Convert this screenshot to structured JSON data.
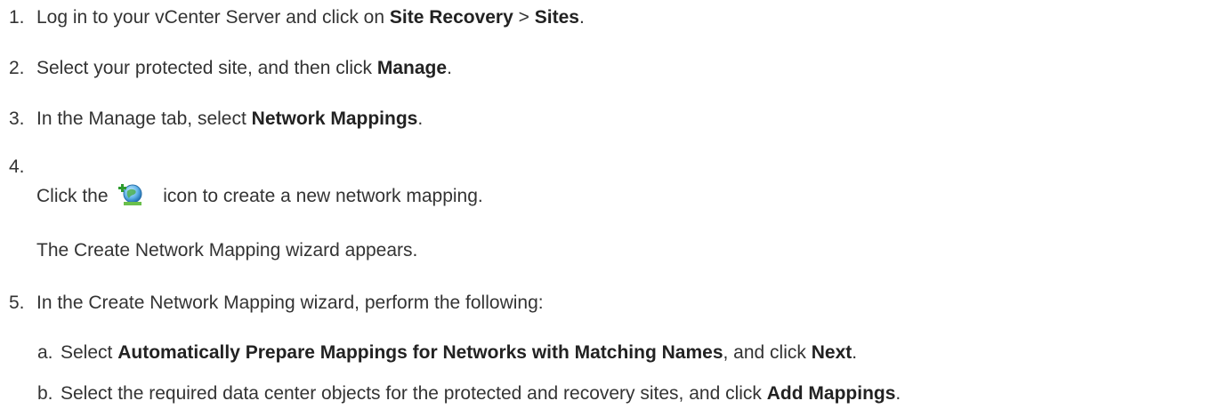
{
  "steps": [
    {
      "num": "1.",
      "t1": "Log in to your vCenter Server and click on ",
      "b1": "Site Recovery",
      "t2": " > ",
      "b2": "Sites",
      "t3": "."
    },
    {
      "num": "2.",
      "t1": "Select your protected site, and then click ",
      "b1": "Manage",
      "t2": "."
    },
    {
      "num": "3.",
      "t1": "In the Manage tab, select ",
      "b1": "Network Mappings",
      "t2": "."
    },
    {
      "num": "4.",
      "click_before": "Click the",
      "click_after": "icon to create a new network mapping.",
      "note": "The Create Network Mapping wizard appears."
    },
    {
      "num": "5.",
      "t1": "In the Create Network Mapping wizard, perform the following:"
    }
  ],
  "substeps": [
    {
      "num": "a.",
      "t1": "Select ",
      "b1": "Automatically Prepare Mappings for Networks with Matching Names",
      "t2": ", and click ",
      "b2": "Next",
      "t3": "."
    },
    {
      "num": "b.",
      "t1": "Select the required data center objects for the protected and recovery sites, and click ",
      "b1": "Add Mappings",
      "t2": "."
    }
  ],
  "icons": {
    "step4": "add-network-mapping-icon"
  }
}
